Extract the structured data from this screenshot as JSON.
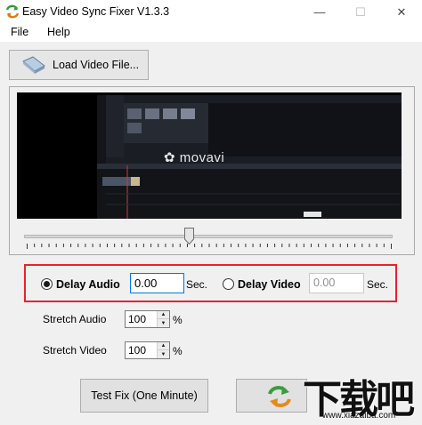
{
  "window": {
    "title": "Easy Video Sync Fixer V1.3.3",
    "minimize_glyph": "—",
    "maximize_glyph": "☐",
    "close_glyph": "✕"
  },
  "menu": {
    "items": [
      {
        "label": "File"
      },
      {
        "label": "Help"
      }
    ]
  },
  "toolbar": {
    "load_label": "Load Video File..."
  },
  "preview": {
    "watermark_text": "✿ movavi"
  },
  "timeline": {
    "position": 0.44
  },
  "sync": {
    "delay_audio_label": "Delay Audio",
    "delay_audio_value": "0.00",
    "delay_audio_selected": true,
    "delay_video_label": "Delay Video",
    "delay_video_value": "0.00",
    "delay_video_selected": false,
    "sec_label": "Sec."
  },
  "stretch": {
    "audio_label": "Stretch Audio",
    "audio_value": "100",
    "video_label": "Stretch Video",
    "video_value": "100",
    "percent_label": "%"
  },
  "actions": {
    "test_label": "Test Fix (One Minute)"
  },
  "site_watermark": {
    "big_text": "下载吧",
    "small_text": "www.xiazaiba.com"
  },
  "colors": {
    "highlight_border": "#e8212f",
    "focus_border": "#0078d7"
  }
}
